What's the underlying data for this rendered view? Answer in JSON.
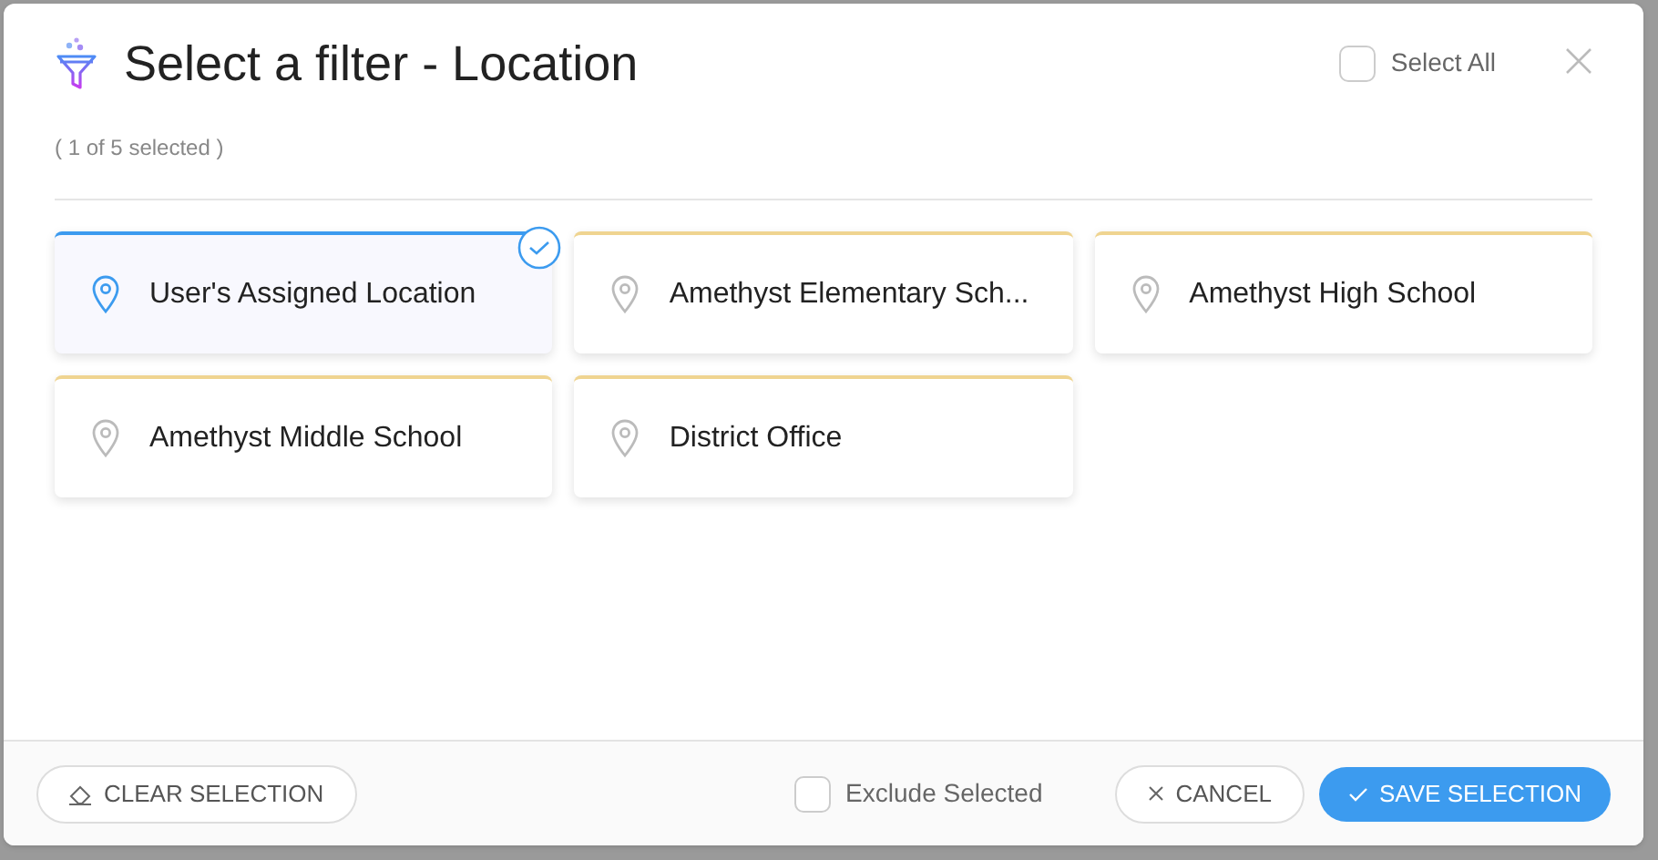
{
  "dialog": {
    "title": "Select a filter - Location",
    "subtitle": "( 1 of 5 selected )",
    "select_all": {
      "label": "Select All",
      "checked": false
    }
  },
  "options": [
    {
      "label": "User's Assigned Location",
      "selected": true
    },
    {
      "label": "Amethyst Elementary Sch...",
      "selected": false
    },
    {
      "label": "Amethyst High School",
      "selected": false
    },
    {
      "label": "Amethyst Middle School",
      "selected": false
    },
    {
      "label": "District Office",
      "selected": false
    }
  ],
  "footer": {
    "clear": "CLEAR SELECTION",
    "exclude": {
      "label": "Exclude Selected",
      "checked": false
    },
    "cancel": "CANCEL",
    "save": "SAVE SELECTION"
  }
}
